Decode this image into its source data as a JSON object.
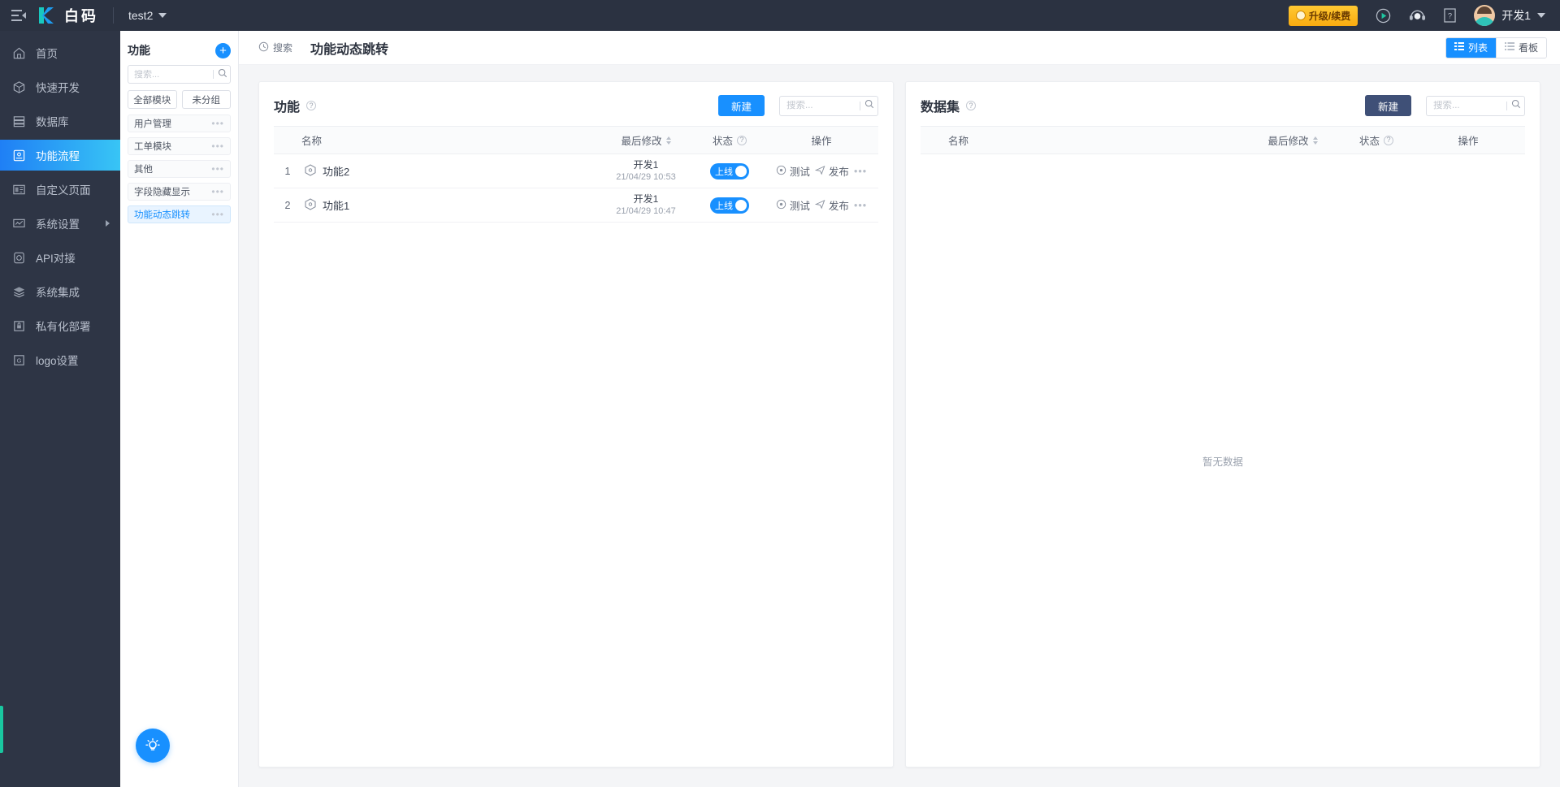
{
  "topbar": {
    "hamburger_icon": "menu-collapse-icon",
    "logo_text": "白码",
    "project_name": "test2",
    "upgrade_label": "升级/续费",
    "icons": [
      "play-circle-icon",
      "headset-icon",
      "help-doc-icon"
    ],
    "username": "开发1"
  },
  "leftnav": {
    "items": [
      {
        "label": "首页",
        "icon": "home-icon",
        "active": false,
        "arrow": false
      },
      {
        "label": "快速开发",
        "icon": "cube-icon",
        "active": false,
        "arrow": false
      },
      {
        "label": "数据库",
        "icon": "database-icon",
        "active": false,
        "arrow": false
      },
      {
        "label": "功能流程",
        "icon": "flow-icon",
        "active": true,
        "arrow": false
      },
      {
        "label": "自定义页面",
        "icon": "page-icon",
        "active": false,
        "arrow": false
      },
      {
        "label": "系统设置",
        "icon": "settings-monitor-icon",
        "active": false,
        "arrow": true
      },
      {
        "label": "API对接",
        "icon": "api-icon",
        "active": false,
        "arrow": false
      },
      {
        "label": "系统集成",
        "icon": "layers-icon",
        "active": false,
        "arrow": false
      },
      {
        "label": "私有化部署",
        "icon": "lock-deploy-icon",
        "active": false,
        "arrow": false
      },
      {
        "label": "logo设置",
        "icon": "logo-settings-icon",
        "active": false,
        "arrow": false
      }
    ]
  },
  "modules": {
    "title": "功能",
    "add_label": "+",
    "search_placeholder": "搜索...",
    "search_value": "",
    "tabs": [
      {
        "label": "全部模块"
      },
      {
        "label": "未分组"
      }
    ],
    "items": [
      {
        "label": "用户管理",
        "selected": false,
        "menu": "•••"
      },
      {
        "label": "工单模块",
        "selected": false,
        "menu": "•••"
      },
      {
        "label": "其他",
        "selected": false,
        "menu": "•••"
      },
      {
        "label": "字段隐藏显示",
        "selected": false,
        "menu": "•••"
      },
      {
        "label": "功能动态跳转",
        "selected": true,
        "menu": "•••"
      }
    ],
    "fab_icon": "lightbulb-icon"
  },
  "main_header": {
    "breadcrumb_icon": "history-clock-icon",
    "breadcrumb_label": "搜索",
    "page_title": "功能动态跳转",
    "view_list_label": "列表",
    "view_board_label": "看板"
  },
  "function_card": {
    "title": "功能",
    "help_icon": "question-icon",
    "new_button": "新建",
    "new_button_color": "#1890ff",
    "search_placeholder": "搜索...",
    "search_value": "",
    "columns": [
      "名称",
      "最后修改",
      "状态",
      "操作"
    ],
    "rows": [
      {
        "index": "1",
        "name": "功能2",
        "name_icon": "hexagon-node-icon",
        "modifier": "开发1",
        "time": "21/04/29 10:53",
        "status_label": "上线",
        "status_on": true,
        "actions": [
          "测试",
          "发布"
        ],
        "more": "•••"
      },
      {
        "index": "2",
        "name": "功能1",
        "name_icon": "hexagon-node-icon",
        "modifier": "开发1",
        "time": "21/04/29 10:47",
        "status_label": "上线",
        "status_on": true,
        "actions": [
          "测试",
          "发布"
        ],
        "more": "•••"
      }
    ]
  },
  "dataset_card": {
    "title": "数据集",
    "help_icon": "question-icon",
    "new_button": "新建",
    "new_button_color": "#3f5077",
    "search_placeholder": "搜索...",
    "search_value": "",
    "columns": [
      "名称",
      "最后修改",
      "状态",
      "操作"
    ],
    "empty_text": "暂无数据"
  }
}
